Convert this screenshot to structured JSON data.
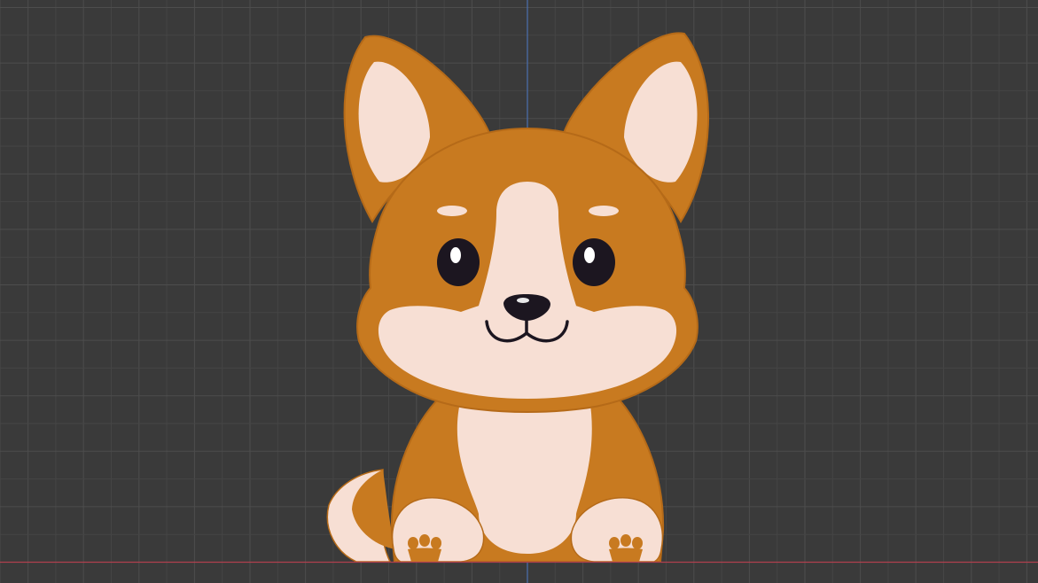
{
  "viewport": {
    "background_color": "#3a3a3a",
    "grid_minor_color": "#454545",
    "grid_major_color": "#4d4d4d",
    "axis_y_color": "#4a6fb0",
    "axis_x_color": "#b0404e"
  },
  "corgi": {
    "fur_color": "#c87a20",
    "outline_color": "#b56a18",
    "cream_color": "#f7dfd4",
    "dark_color": "#1c1620"
  }
}
